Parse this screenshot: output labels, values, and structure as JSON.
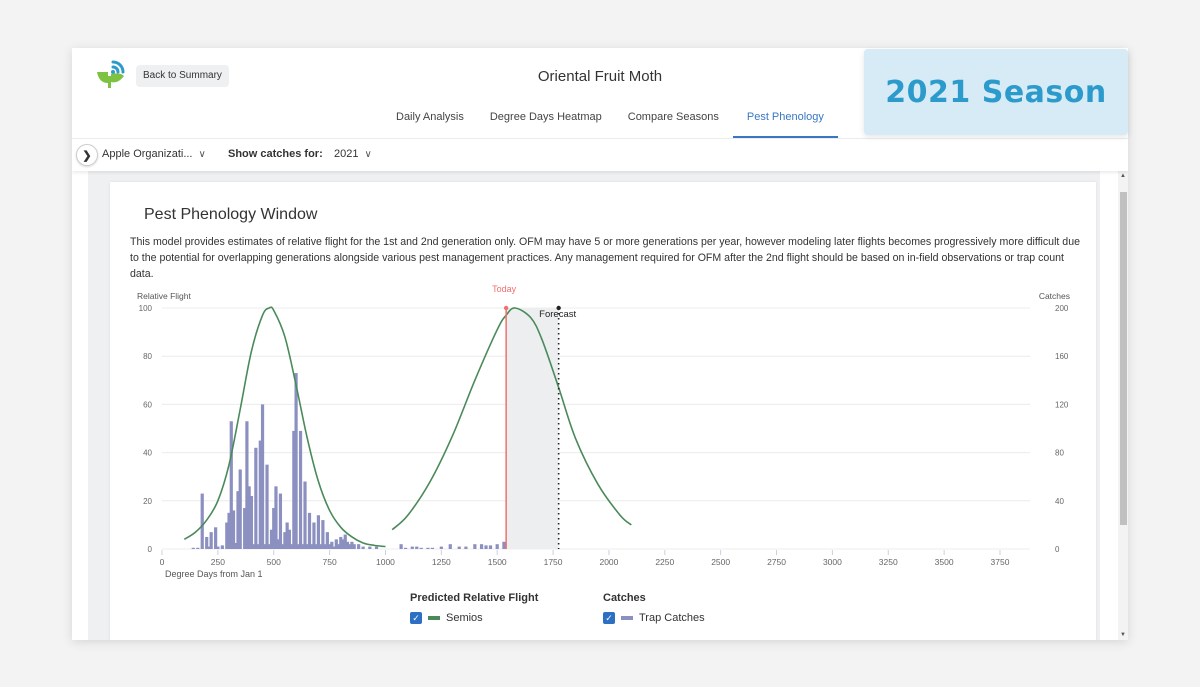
{
  "header": {
    "logo": "semios-logo-icon",
    "back_button": "Back to Summary",
    "title": "Oriental Fruit Moth",
    "tabs": [
      {
        "label": "Daily Analysis",
        "active": false
      },
      {
        "label": "Degree Days Heatmap",
        "active": false
      },
      {
        "label": "Compare Seasons",
        "active": false
      },
      {
        "label": "Pest Phenology",
        "active": true
      }
    ]
  },
  "season_badge": "2021 Season",
  "filters": {
    "expand_icon": "chevron-right-icon",
    "organization": "Apple Organizati...",
    "show_catches_label": "Show catches for:",
    "year": "2021"
  },
  "card": {
    "title": "Pest Phenology Window",
    "description": "This model provides estimates of relative flight for the 1st and 2nd generation only. OFM may have 5 or more generations per year, however modeling later flights becomes progressively more difficult due to the potential for overlapping generations alongside various pest management practices. Any management required for OFM after the 2nd flight should be based on in-field observations or trap count data."
  },
  "legend": {
    "flight_title": "Predicted Relative Flight",
    "flight_item": "Semios",
    "flight_checked": true,
    "catches_title": "Catches",
    "catches_item": "Trap Catches",
    "catches_checked": true
  },
  "colors": {
    "curve": "#4a8a5a",
    "bars": "#8b90c0",
    "today": "#f07070",
    "forecast_shade": "#eceef0",
    "accent": "#3a76c4",
    "badge_text": "#2c9bcb"
  },
  "chart_data": {
    "type": "bar+line",
    "title": "Pest Phenology Window",
    "xlabel": "Degree Days from Jan 1",
    "ylabel_left": "Relative Flight",
    "ylabel_right": "Catches",
    "xlim": [
      0,
      3750
    ],
    "xticks": [
      0,
      250,
      500,
      750,
      1000,
      1250,
      1500,
      1750,
      2000,
      2250,
      2500,
      2750,
      3000,
      3250,
      3500,
      3750
    ],
    "ylim_left": [
      0,
      100
    ],
    "yticks_left": [
      0,
      20,
      40,
      60,
      80,
      100
    ],
    "ylim_right": [
      0,
      200
    ],
    "yticks_right": [
      0,
      40,
      80,
      120,
      160,
      200
    ],
    "grid": true,
    "today": {
      "label": "Today",
      "x": 1540
    },
    "forecast": {
      "label": "Forecast",
      "x": 1775
    },
    "series": [
      {
        "name": "Semios",
        "type": "line",
        "axis": "left",
        "segments": [
          {
            "x": [
              100,
              150,
              200,
              250,
              300,
              350,
              400,
              450,
              480,
              500,
              550,
              600,
              650,
              700,
              750,
              800,
              850,
              900,
              950,
              1000
            ],
            "y": [
              4,
              7,
              12,
              20,
              35,
              58,
              82,
              97,
              100,
              99,
              88,
              68,
              46,
              28,
              16,
              9,
              5,
              2.5,
              1.5,
              1
            ]
          },
          {
            "x": [
              1030,
              1100,
              1200,
              1300,
              1400,
              1500,
              1540,
              1580,
              1650,
              1700,
              1775,
              1850,
              1950,
              2050,
              2100
            ],
            "y": [
              8,
              14,
              28,
              47,
              70,
              91,
              97,
              100,
              96,
              87,
              67,
              46,
              27,
              14,
              10
            ]
          }
        ]
      },
      {
        "name": "Trap Catches",
        "type": "bar",
        "axis": "right",
        "x": [
          140,
          160,
          180,
          200,
          210,
          220,
          240,
          250,
          270,
          290,
          300,
          310,
          320,
          330,
          340,
          350,
          370,
          380,
          390,
          400,
          410,
          420,
          430,
          440,
          450,
          460,
          470,
          480,
          490,
          500,
          510,
          520,
          530,
          540,
          550,
          560,
          570,
          580,
          590,
          600,
          610,
          620,
          630,
          640,
          650,
          660,
          670,
          680,
          690,
          700,
          710,
          720,
          730,
          740,
          750,
          760,
          770,
          780,
          790,
          800,
          810,
          820,
          830,
          840,
          850,
          860,
          880,
          900,
          930,
          960,
          1070,
          1090,
          1120,
          1140,
          1160,
          1190,
          1210,
          1250,
          1290,
          1330,
          1360,
          1400,
          1430,
          1450,
          1470,
          1500,
          1530
        ],
        "y": [
          1,
          1,
          46,
          10,
          2,
          14,
          18,
          2,
          3,
          22,
          30,
          106,
          32,
          5,
          48,
          66,
          34,
          106,
          52,
          44,
          4,
          84,
          4,
          90,
          120,
          4,
          70,
          4,
          16,
          34,
          52,
          8,
          46,
          4,
          14,
          22,
          16,
          4,
          98,
          146,
          4,
          98,
          4,
          56,
          4,
          30,
          4,
          22,
          4,
          28,
          4,
          24,
          4,
          14,
          4,
          6,
          2,
          8,
          4,
          10,
          8,
          12,
          6,
          4,
          6,
          4,
          4,
          2,
          2,
          2,
          4,
          1,
          2,
          2,
          1,
          1,
          1,
          2,
          4,
          2,
          2,
          4,
          4,
          3,
          3,
          4,
          6
        ]
      }
    ]
  }
}
